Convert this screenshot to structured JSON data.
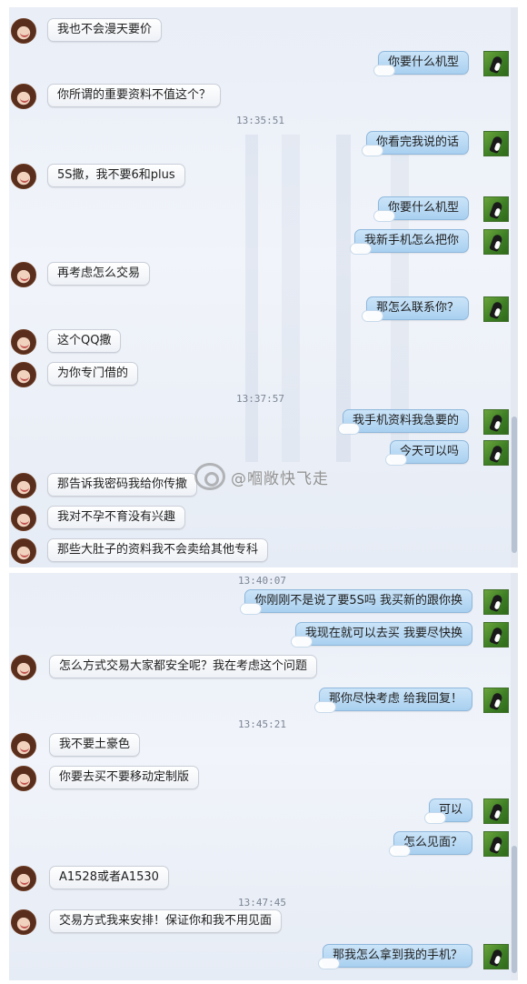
{
  "panel_top": {
    "messages": [
      {
        "side": "in",
        "text": "我也不会漫天要价"
      },
      {
        "side": "out",
        "text": "你要什么机型"
      },
      {
        "side": "in",
        "text": "你所谓的重要资料不值这个？"
      },
      {
        "side": "time",
        "text": "13:35:51"
      },
      {
        "side": "out",
        "text": "你看完我说的话"
      },
      {
        "side": "in",
        "text": "5S撒，我不要6和plus"
      },
      {
        "side": "out",
        "text": "你要什么机型"
      },
      {
        "side": "out",
        "text": "我新手机怎么把你"
      },
      {
        "side": "in",
        "text": "再考虑怎么交易"
      },
      {
        "side": "out",
        "text": "那怎么联系你？"
      },
      {
        "side": "in",
        "text": "这个QQ撒"
      },
      {
        "side": "in",
        "text": "为你专门借的"
      },
      {
        "side": "time",
        "text": "13:37:57"
      },
      {
        "side": "out",
        "text": "我手机资料我急要的"
      },
      {
        "side": "out",
        "text": "今天可以吗"
      },
      {
        "side": "in",
        "text": "那告诉我密码我给你传撒"
      },
      {
        "side": "in",
        "text": "我对不孕不育没有兴趣"
      },
      {
        "side": "in",
        "text": "那些大肚子的资料我不会卖给其他专科"
      }
    ]
  },
  "watermark": {
    "icon": "weibo-icon",
    "text": "@嗰敞快飞走"
  },
  "panel_bottom": {
    "messages": [
      {
        "side": "time",
        "text": "13:40:07"
      },
      {
        "side": "out",
        "text": "你刚刚不是说了要5S吗 我买新的跟你换"
      },
      {
        "side": "out",
        "text": "我现在就可以去买 我要尽快换"
      },
      {
        "side": "in",
        "text": "怎么方式交易大家都安全呢？我在考虑这个问题"
      },
      {
        "side": "out",
        "text": "那你尽快考虑 给我回复！"
      },
      {
        "side": "time",
        "text": "13:45:21"
      },
      {
        "side": "in",
        "text": "我不要土豪色"
      },
      {
        "side": "in",
        "text": "你要去买不要移动定制版"
      },
      {
        "side": "out",
        "text": "可以"
      },
      {
        "side": "out",
        "text": "怎么见面？"
      },
      {
        "side": "in",
        "text": "A1528或者A1530"
      },
      {
        "side": "time",
        "text": "13:47:45"
      },
      {
        "side": "in",
        "text": "交易方式我来安排！保证你和我不用见面"
      },
      {
        "side": "out",
        "text": "那我怎么拿到我的手机？"
      }
    ]
  },
  "colors": {
    "outgoing_bubble": "#a9d0f0",
    "incoming_bubble": "#ffffff",
    "background": "#e9eef7"
  }
}
